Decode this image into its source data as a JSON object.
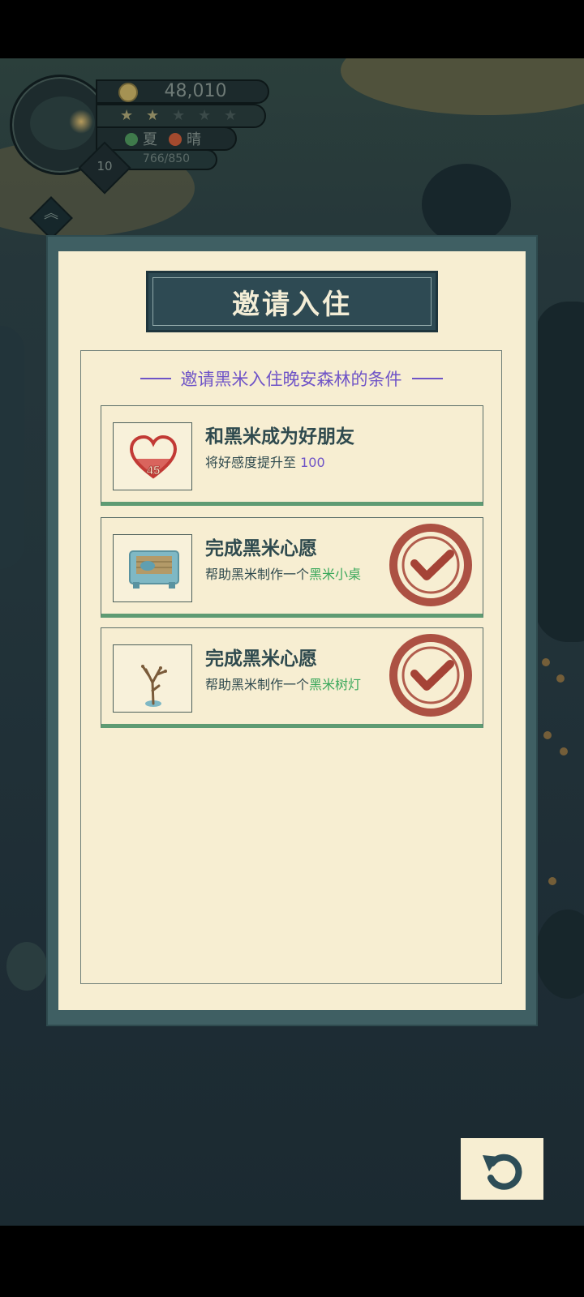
{
  "hud": {
    "coins": "48,010",
    "stars_filled": 2,
    "stars_total": 5,
    "season": "夏",
    "weather": "晴",
    "exp": "766/850",
    "level": "10"
  },
  "modal": {
    "title": "邀请入住",
    "subtitle": "邀请黑米入住晚安森林的条件",
    "conditions": [
      {
        "title": "和黑米成为好朋友",
        "desc_prefix": "将好感度提升至 ",
        "desc_value": "100",
        "icon": "heart-icon",
        "icon_value": "45",
        "progress_fraction": 0.45,
        "completed": false
      },
      {
        "title": "完成黑米心愿",
        "desc_prefix": "帮助黑米制作一个",
        "desc_value": "黑米小桌",
        "icon": "table-icon",
        "completed": true
      },
      {
        "title": "完成黑米心愿",
        "desc_prefix": "帮助黑米制作一个",
        "desc_value": "黑米树灯",
        "icon": "tree-lamp-icon",
        "completed": true
      }
    ]
  },
  "back_button": {
    "icon": "back-arrow-icon"
  },
  "colors": {
    "frame": "#3f5f63",
    "paper": "#f7eed2",
    "title_banner": "#2e4a53",
    "accent_purple": "#6f54c7",
    "accent_green": "#3aa85b",
    "stamp_red": "#a54336",
    "item_underline": "#5e9b73"
  }
}
